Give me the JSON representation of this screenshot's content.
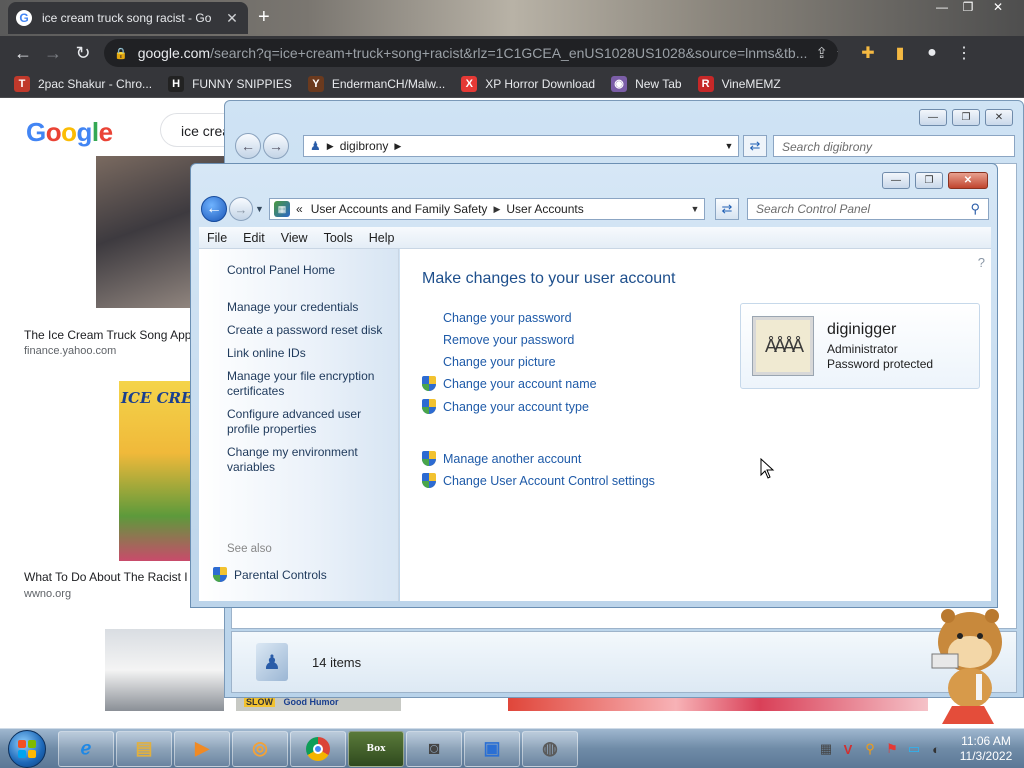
{
  "browser": {
    "tab_title": "ice cream truck song racist - Go",
    "url_host": "google.com",
    "url_rest": "/search?q=ice+cream+truck+song+racist&rlz=1C1GCEA_enUS1028US1028&source=lnms&tb...",
    "bookmarks": [
      {
        "label": "2pac Shakur - Chro...",
        "icon": "T",
        "color": "#c0392b"
      },
      {
        "label": "FUNNY SNIPPIES",
        "icon": "H",
        "color": "#222222"
      },
      {
        "label": "EndermanCH/Malw...",
        "icon": "Y",
        "color": "#6b3a1e"
      },
      {
        "label": "XP Horror Download",
        "icon": "X",
        "color": "#e53935"
      },
      {
        "label": "New Tab",
        "icon": "◉",
        "color": "#7b5ea7"
      },
      {
        "label": "VineMEMZ",
        "icon": "R",
        "color": "#c62828"
      }
    ]
  },
  "google": {
    "logo": "Google",
    "search_text": "ice crea",
    "results": [
      {
        "caption": "The Ice Cream Truck Song App",
        "source": "finance.yahoo.com"
      },
      {
        "caption": "What To Do About The Racist I",
        "source": "wwno.org"
      }
    ],
    "truck_sign": "ICE CRE",
    "sign_bottom": "Good Humor",
    "sign_slow": "SLOW"
  },
  "back_window": {
    "address": "digibrony",
    "search_placeholder": "Search digibrony",
    "item_count": "14 items"
  },
  "control_panel": {
    "breadcrumb": [
      "User Accounts and Family Safety",
      "User Accounts"
    ],
    "breadcrumb_prefix": "«",
    "search_placeholder": "Search Control Panel",
    "menu": [
      "File",
      "Edit",
      "View",
      "Tools",
      "Help"
    ],
    "left_links": [
      "Control Panel Home",
      "Manage your credentials",
      "Create a password reset disk",
      "Link online IDs",
      "Manage your file encryption certificates",
      "Configure advanced user profile properties",
      "Change my environment variables"
    ],
    "see_also_label": "See also",
    "see_also_links": [
      "Parental Controls"
    ],
    "heading": "Make changes to your user account",
    "tasks": [
      "Change your password",
      "Remove your password",
      "Change your picture",
      "Change your account name",
      "Change your account type"
    ],
    "other_tasks": [
      "Manage another account",
      "Change User Account Control settings"
    ],
    "account": {
      "name": "diginigger",
      "type": "Administrator",
      "status": "Password protected",
      "avatar_text": "ÅÅÅÅ"
    }
  },
  "taskbar": {
    "time": "11:06 AM",
    "date": "11/3/2022",
    "box_label": "Box",
    "tray_red_letter": "V"
  }
}
